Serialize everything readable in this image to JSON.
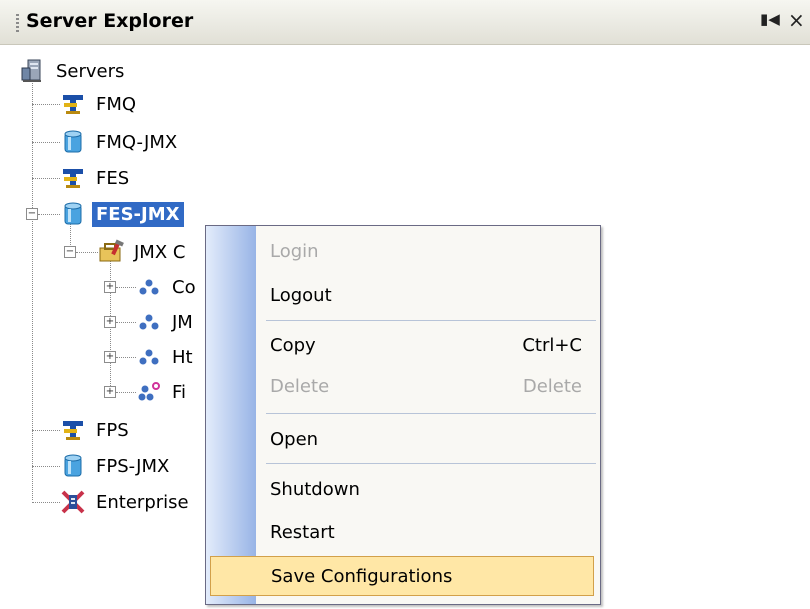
{
  "panel": {
    "title": "Server Explorer",
    "pin_icon": "auto-hide-pin-icon",
    "close_icon": "close-icon"
  },
  "tree": {
    "root": {
      "label": "Servers",
      "icon": "servers-icon"
    },
    "nodes": [
      {
        "label": "FMQ",
        "icon": "server-f-icon"
      },
      {
        "label": "FMQ-JMX",
        "icon": "jmx-cylinder-icon"
      },
      {
        "label": "FES",
        "icon": "server-f-icon"
      },
      {
        "label": "FES-JMX",
        "icon": "jmx-cylinder-icon",
        "expanded": true,
        "selected": true
      },
      {
        "label": "JMX C",
        "icon": "jmx-toolbox-icon",
        "expanded": true
      },
      {
        "label": "Co",
        "icon": "connection-group-icon"
      },
      {
        "label": "JM",
        "icon": "connection-group-icon"
      },
      {
        "label": "Ht",
        "icon": "connection-group-icon"
      },
      {
        "label": "Fi",
        "icon": "connection-group-pink-icon"
      },
      {
        "label": "FPS",
        "icon": "server-f-icon"
      },
      {
        "label": "FPS-JMX",
        "icon": "jmx-cylinder-icon"
      },
      {
        "label": "Enterprise",
        "icon": "enterprise-x-icon"
      }
    ]
  },
  "context_menu": {
    "items": [
      {
        "label": "Login",
        "shortcut": "",
        "disabled": true
      },
      {
        "label": "Logout",
        "shortcut": "",
        "disabled": false
      },
      {
        "label": "Copy",
        "shortcut": "Ctrl+C",
        "disabled": false
      },
      {
        "label": "Delete",
        "shortcut": "Delete",
        "disabled": true
      },
      {
        "label": "Open",
        "shortcut": "",
        "disabled": false
      },
      {
        "label": "Shutdown",
        "shortcut": "",
        "disabled": false
      },
      {
        "label": "Restart",
        "shortcut": "",
        "disabled": false
      },
      {
        "label": "Save Configurations",
        "shortcut": "",
        "disabled": false,
        "highlighted": true
      }
    ]
  },
  "colors": {
    "selection": "#316ac5",
    "menu_highlight": "#ffe7a6",
    "menu_gutter": "#98b4e6"
  }
}
